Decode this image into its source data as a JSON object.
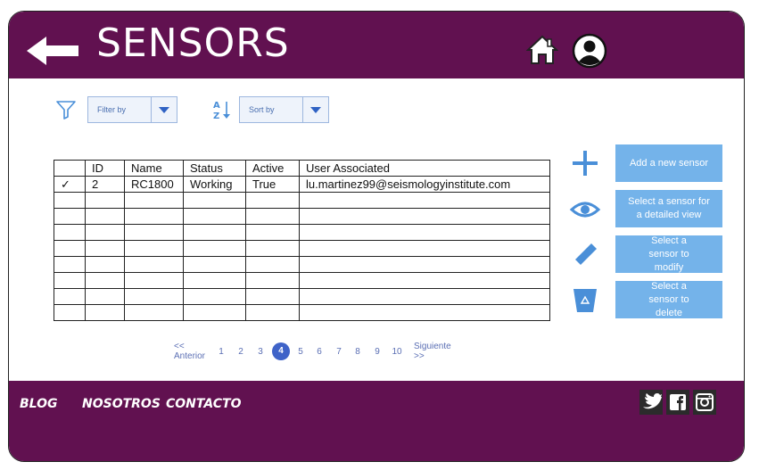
{
  "header": {
    "title": "SENSORS"
  },
  "toolbar": {
    "filter_label": "Filter by",
    "sort_label": "Sort by"
  },
  "table": {
    "columns": [
      "",
      "ID",
      "Name",
      "Status",
      "Active",
      "User Associated"
    ],
    "rows": [
      [
        "✓",
        "2",
        "RC1800",
        "Working",
        "True",
        "lu.martinez99@seismologyinstitute.com"
      ],
      [
        "",
        "",
        "",
        "",
        "",
        ""
      ],
      [
        "",
        "",
        "",
        "",
        "",
        ""
      ],
      [
        "",
        "",
        "",
        "",
        "",
        ""
      ],
      [
        "",
        "",
        "",
        "",
        "",
        ""
      ],
      [
        "",
        "",
        "",
        "",
        "",
        ""
      ],
      [
        "",
        "",
        "",
        "",
        "",
        ""
      ],
      [
        "",
        "",
        "",
        "",
        "",
        ""
      ],
      [
        "",
        "",
        "",
        "",
        "",
        ""
      ]
    ]
  },
  "actions": [
    {
      "icon": "plus-icon",
      "label": "Add a new sensor"
    },
    {
      "icon": "eye-icon",
      "label": "Select a sensor for a detailed view"
    },
    {
      "icon": "pencil-icon",
      "label": "Select a sensor to modify"
    },
    {
      "icon": "trash-icon",
      "label": "Select a sensor to delete"
    }
  ],
  "pagination": {
    "prev_line1": "<<",
    "prev_line2": "Anterior",
    "next_line1": "Siguiente",
    "next_line2": ">>",
    "pages": [
      "1",
      "2",
      "3",
      "4",
      "5",
      "6",
      "7",
      "8",
      "9",
      "10"
    ],
    "current": "4"
  },
  "footer": {
    "links": [
      "BLOG",
      "NOSOTROS",
      "CONTACTO"
    ],
    "social": [
      "twitter-icon",
      "facebook-icon",
      "instagram-icon"
    ]
  },
  "colors": {
    "brand": "#611150",
    "accent": "#74b3ea",
    "pager_active": "#3f63c8"
  }
}
